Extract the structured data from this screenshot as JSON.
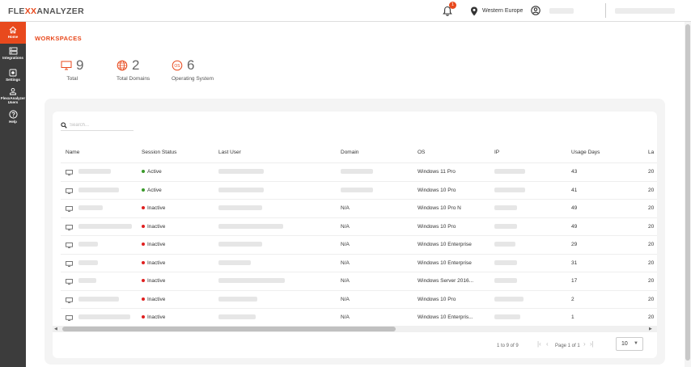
{
  "app": {
    "logo_left": "FLE",
    "logo_accent": "XX",
    "logo_right": "ANALYZER",
    "notification_count": "1",
    "region": "Western Europe"
  },
  "sidebar": {
    "items": [
      {
        "label": "Home",
        "icon": "home-icon"
      },
      {
        "label": "Integrations",
        "icon": "integrations-icon"
      },
      {
        "label": "Settings",
        "icon": "settings-icon"
      },
      {
        "label": "FlexxAnalyzer Users",
        "icon": "user-icon"
      },
      {
        "label": "Help",
        "icon": "help-icon"
      }
    ]
  },
  "page": {
    "title": "WORKSPACES",
    "stats": [
      {
        "value": "9",
        "label": "Total",
        "icon": "monitor-icon"
      },
      {
        "value": "2",
        "label": "Total Domains",
        "icon": "globe-icon"
      },
      {
        "value": "6",
        "label": "Operating System",
        "icon": "os-icon"
      }
    ],
    "search_placeholder": "Search..."
  },
  "table": {
    "columns": [
      "Name",
      "Session Status",
      "Last User",
      "Domain",
      "OS",
      "IP",
      "Usage Days",
      "La"
    ],
    "rows": [
      {
        "status": "Active",
        "domain": "",
        "os": "Windows 11 Pro",
        "days": "43",
        "last": "20"
      },
      {
        "status": "Active",
        "domain": "",
        "os": "Windows 10 Pro",
        "days": "41",
        "last": "20"
      },
      {
        "status": "Inactive",
        "domain": "N/A",
        "os": "Windows 10 Pro N",
        "days": "49",
        "last": "20"
      },
      {
        "status": "Inactive",
        "domain": "N/A",
        "os": "Windows 10 Pro",
        "days": "49",
        "last": "20"
      },
      {
        "status": "Inactive",
        "domain": "N/A",
        "os": "Windows 10 Enterprise",
        "days": "29",
        "last": "20"
      },
      {
        "status": "Inactive",
        "domain": "N/A",
        "os": "Windows 10 Enterprise",
        "days": "31",
        "last": "20"
      },
      {
        "status": "Inactive",
        "domain": "N/A",
        "os": "Windows Server 2016...",
        "days": "17",
        "last": "20"
      },
      {
        "status": "Inactive",
        "domain": "N/A",
        "os": "Windows 10 Pro",
        "days": "2",
        "last": "20"
      },
      {
        "status": "Inactive",
        "domain": "N/A",
        "os": "Windows 10 Enterpris...",
        "days": "1",
        "last": "20"
      }
    ]
  },
  "pagination": {
    "range": "1 to 9 of 9",
    "page": "Page 1 of 1",
    "page_size": "10"
  },
  "colors": {
    "accent": "#e8491d",
    "active": "#3a9a2a",
    "inactive": "#e02020",
    "sidebar": "#3c3c3c"
  }
}
